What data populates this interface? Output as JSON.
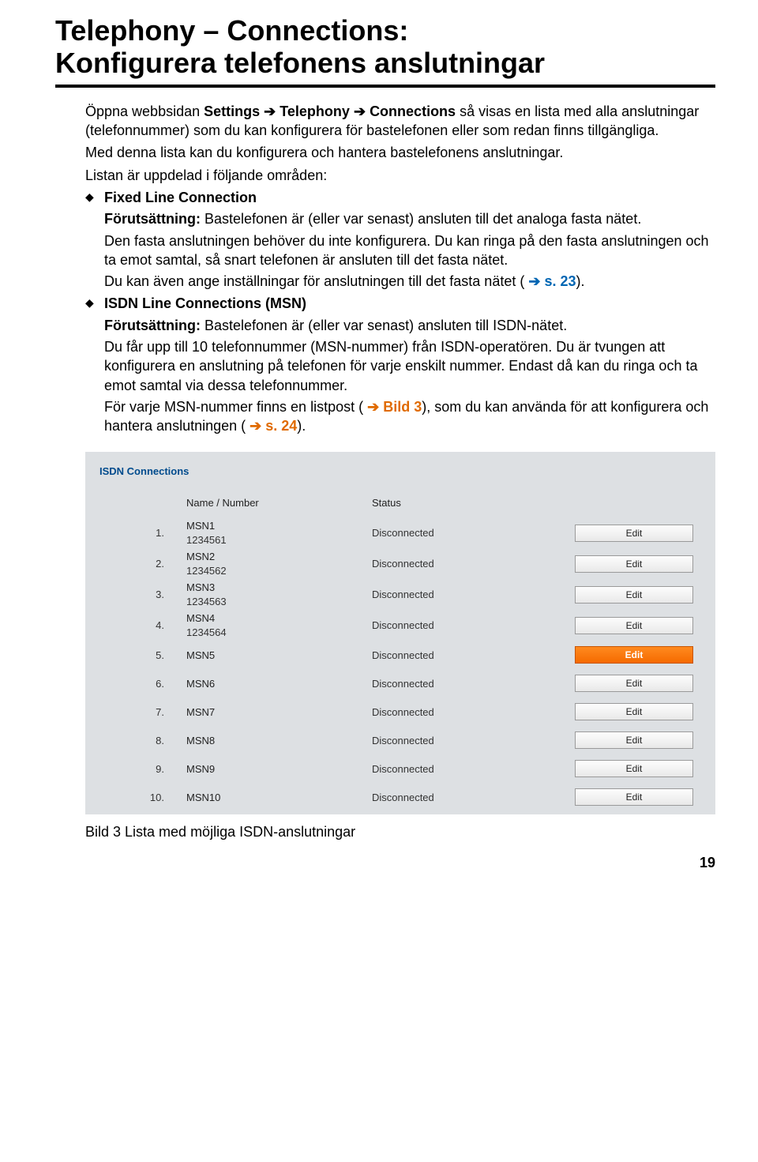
{
  "heading_line1": "Telephony – Connections:",
  "heading_line2": "Konfigurera telefonens anslutningar",
  "intro": {
    "p1a": "Öppna webbsidan ",
    "p1b": "Settings",
    "p1c": "Telephony",
    "p1d": "Connections",
    "p1e": " så visas en lista med alla anslutningar (telefonnummer) som du kan konfigurera för bastelefonen eller som redan finns tillgängliga.",
    "p2": "Med denna lista kan du konfigurera och hantera bastelefonens anslutningar.",
    "p3": "Listan är uppdelad i följande områden:"
  },
  "bullets": {
    "fixed": {
      "title": "Fixed Line Connection",
      "pre_label": "Förutsättning:",
      "pre_text": " Bastelefonen är (eller var senast) ansluten till det analoga fasta nätet.",
      "p1": "Den fasta anslutningen behöver du inte konfigurera. Du kan ringa på den fasta anslutningen och ta emot samtal, så snart telefonen är ansluten till det fasta nätet.",
      "p2a": "Du kan även ange inställningar för anslutningen till det fasta nätet ( ",
      "p2_ref": "s. 23",
      "p2b": ")."
    },
    "isdn": {
      "title": "ISDN Line Connections (MSN)",
      "pre_label": "Förutsättning:",
      "pre_text": " Bastelefonen är (eller var senast) ansluten till ISDN-nätet.",
      "p1": "Du får upp till 10 telefonnummer (MSN-nummer) från ISDN-operatören. Du är tvungen att konfigurera en anslutning på telefonen för varje enskilt nummer. Endast då kan du ringa och ta emot samtal via dessa telefonnummer.",
      "p2a": "För varje MSN-nummer finns en listpost ( ",
      "p2_ref1": "Bild 3",
      "p2b": "), som du kan använda för att konfigurera och hantera anslutningen ( ",
      "p2_ref2": "s. 24",
      "p2c": ")."
    }
  },
  "panel": {
    "title": "ISDN Connections",
    "hdr_name": "Name / Number",
    "hdr_status": "Status",
    "edit_label": "Edit",
    "rows": [
      {
        "idx": "1.",
        "name": "MSN1",
        "num": "1234561",
        "status": "Disconnected",
        "active": false
      },
      {
        "idx": "2.",
        "name": "MSN2",
        "num": "1234562",
        "status": "Disconnected",
        "active": false
      },
      {
        "idx": "3.",
        "name": "MSN3",
        "num": "1234563",
        "status": "Disconnected",
        "active": false
      },
      {
        "idx": "4.",
        "name": "MSN4",
        "num": "1234564",
        "status": "Disconnected",
        "active": false
      },
      {
        "idx": "5.",
        "name": "MSN5",
        "num": "",
        "status": "Disconnected",
        "active": true
      },
      {
        "idx": "6.",
        "name": "MSN6",
        "num": "",
        "status": "Disconnected",
        "active": false
      },
      {
        "idx": "7.",
        "name": "MSN7",
        "num": "",
        "status": "Disconnected",
        "active": false
      },
      {
        "idx": "8.",
        "name": "MSN8",
        "num": "",
        "status": "Disconnected",
        "active": false
      },
      {
        "idx": "9.",
        "name": "MSN9",
        "num": "",
        "status": "Disconnected",
        "active": false
      },
      {
        "idx": "10.",
        "name": "MSN10",
        "num": "",
        "status": "Disconnected",
        "active": false
      }
    ]
  },
  "caption": "Bild 3   Lista med möjliga ISDN-anslutningar",
  "page_number": "19"
}
